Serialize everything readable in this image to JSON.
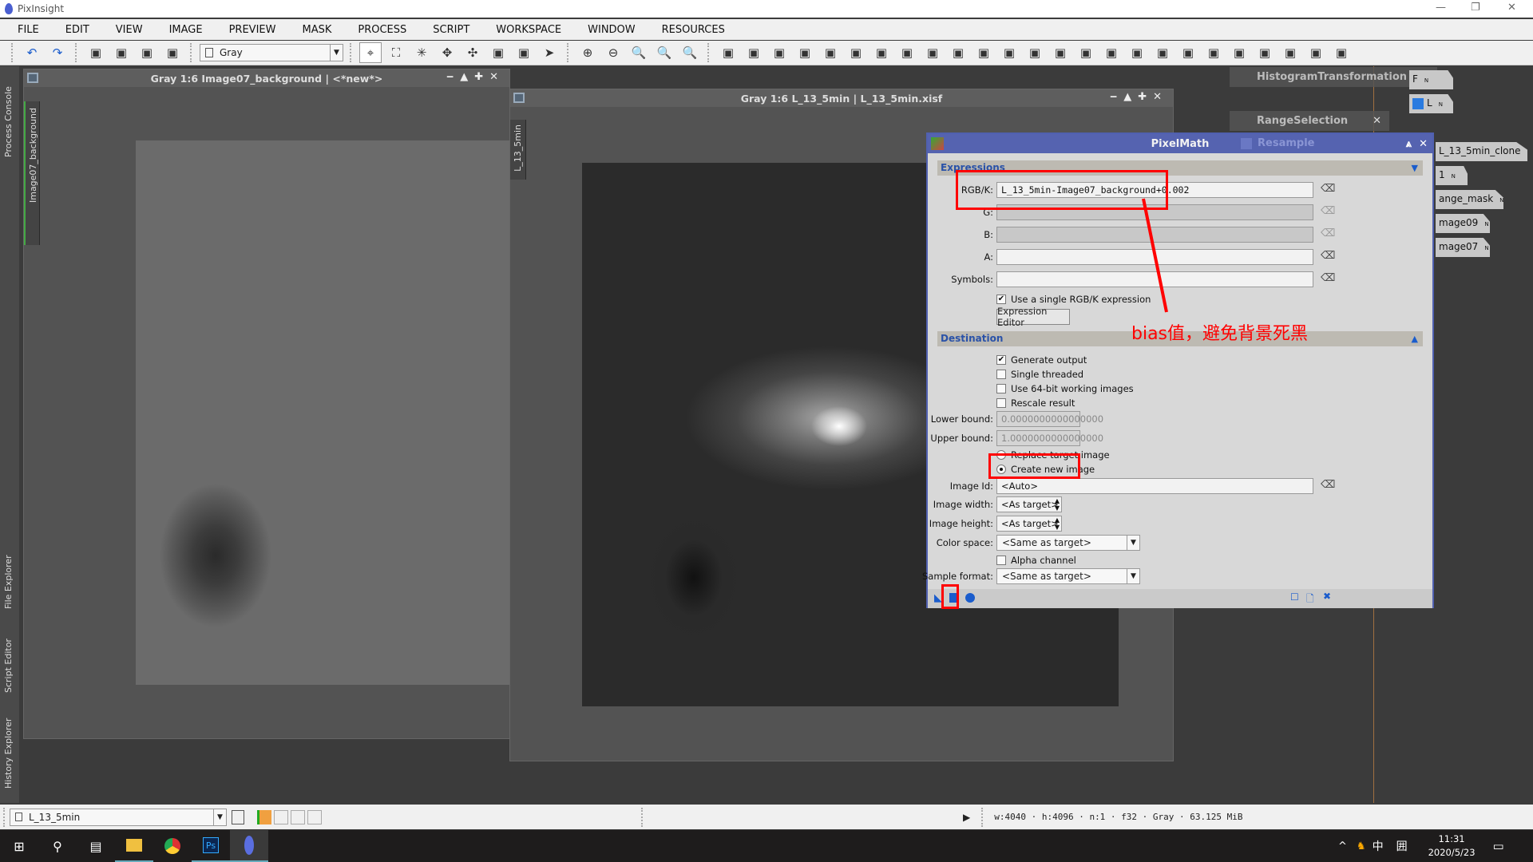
{
  "app": {
    "title": "PixInsight"
  },
  "menu": [
    "FILE",
    "EDIT",
    "VIEW",
    "IMAGE",
    "PREVIEW",
    "MASK",
    "PROCESS",
    "SCRIPT",
    "WORKSPACE",
    "WINDOW",
    "RESOURCES"
  ],
  "toolbar": {
    "color_mode": "Gray",
    "icons_left": [
      "undo-icon",
      "redo-icon"
    ],
    "icons_mid": [
      "image-info-icon",
      "new-image-icon",
      "mask-icon",
      "mask-invert-icon"
    ],
    "icons_nav": [
      "readout-icon",
      "zoom-fit-icon",
      "zoom-shrink-icon",
      "pan-icon",
      "center-icon",
      "preview-icon",
      "preview-edit-icon",
      "pointer-icon"
    ],
    "icons_zoom": [
      "zoom-in-icon",
      "zoom-out-icon",
      "zoom-1-icon",
      "zoom-2-icon",
      "zoom-3-icon"
    ],
    "icons_right": [
      "select-icon",
      "select-all-icon",
      "frame-icon",
      "window-icon",
      "fullscreen-icon",
      "stf-icon",
      "stf-auto-icon",
      "stf-reset-icon",
      "stf-link-icon",
      "active-icon",
      "process-icon",
      "script-icon",
      "history-icon",
      "shelf-icon",
      "console-icon",
      "layout-icon",
      "layout2-icon",
      "layout3-icon",
      "layout4-icon",
      "layout5-icon",
      "monitor-icon",
      "monitor2-icon",
      "screen-icon",
      "screen2-icon",
      "screen3-icon"
    ]
  },
  "side_tabs": [
    "Process Console",
    "File Explorer",
    "Script Editor",
    "History Explorer"
  ],
  "window1": {
    "title": "Gray 1:6 Image07_background | <*new*>",
    "tab": "Image07_background"
  },
  "window2": {
    "title": "Gray 1:6 L_13_5min | L_13_5min.xisf",
    "tab": "L_13_5min"
  },
  "panels": [
    "HistogramTransformation",
    "RangeSelection",
    "Resample"
  ],
  "shelf_images": [
    "L_13_5min_clone",
    "1",
    "ange_mask",
    "mage09",
    "mage07"
  ],
  "shelf_icons": [
    "F",
    "L"
  ],
  "pixelmath": {
    "title": "PixelMath",
    "expressions": {
      "header": "Expressions",
      "rgbk_label": "RGB/K:",
      "rgbk": "L_13_5min-Image07_background+0.002",
      "g_label": "G:",
      "g": "",
      "b_label": "B:",
      "b": "",
      "a_label": "A:",
      "a": "",
      "symbols_label": "Symbols:",
      "symbols": "",
      "single_expr": "Use a single RGB/K expression",
      "single_expr_checked": true,
      "editor_button": "Expression Editor"
    },
    "destination": {
      "header": "Destination",
      "generate_output": "Generate output",
      "generate_output_checked": true,
      "single_threaded": "Single threaded",
      "use64": "Use 64-bit working images",
      "rescale": "Rescale result",
      "lower_label": "Lower bound:",
      "lower": "0.0000000000000000",
      "upper_label": "Upper bound:",
      "upper": "1.0000000000000000",
      "replace": "Replace target image",
      "create": "Create new image",
      "selected": "Create new image",
      "id_label": "Image Id:",
      "id": "<Auto>",
      "width_label": "Image width:",
      "width": "<As target>",
      "height_label": "Image height:",
      "height": "<As target>",
      "cs_label": "Color space:",
      "cs": "<Same as target>",
      "alpha": "Alpha channel",
      "sf_label": "Sample format:",
      "sf": "<Same as target>"
    }
  },
  "annotation": {
    "text": "bias值，避免背景死黑",
    "color": "#ff0000"
  },
  "status": {
    "view": "L_13_5min",
    "info": "w:4040 · h:4096 · n:1 · f32 · Gray · 63.125 MiB"
  },
  "taskbar": {
    "time": "11:31",
    "date": "2020/5/23",
    "ime": "中",
    "apps": [
      "windows-icon",
      "search-icon",
      "task-view-icon",
      "file-explorer-icon",
      "chrome-icon",
      "photoshop-icon",
      "pixinsight-icon"
    ],
    "ps": "Ps"
  }
}
